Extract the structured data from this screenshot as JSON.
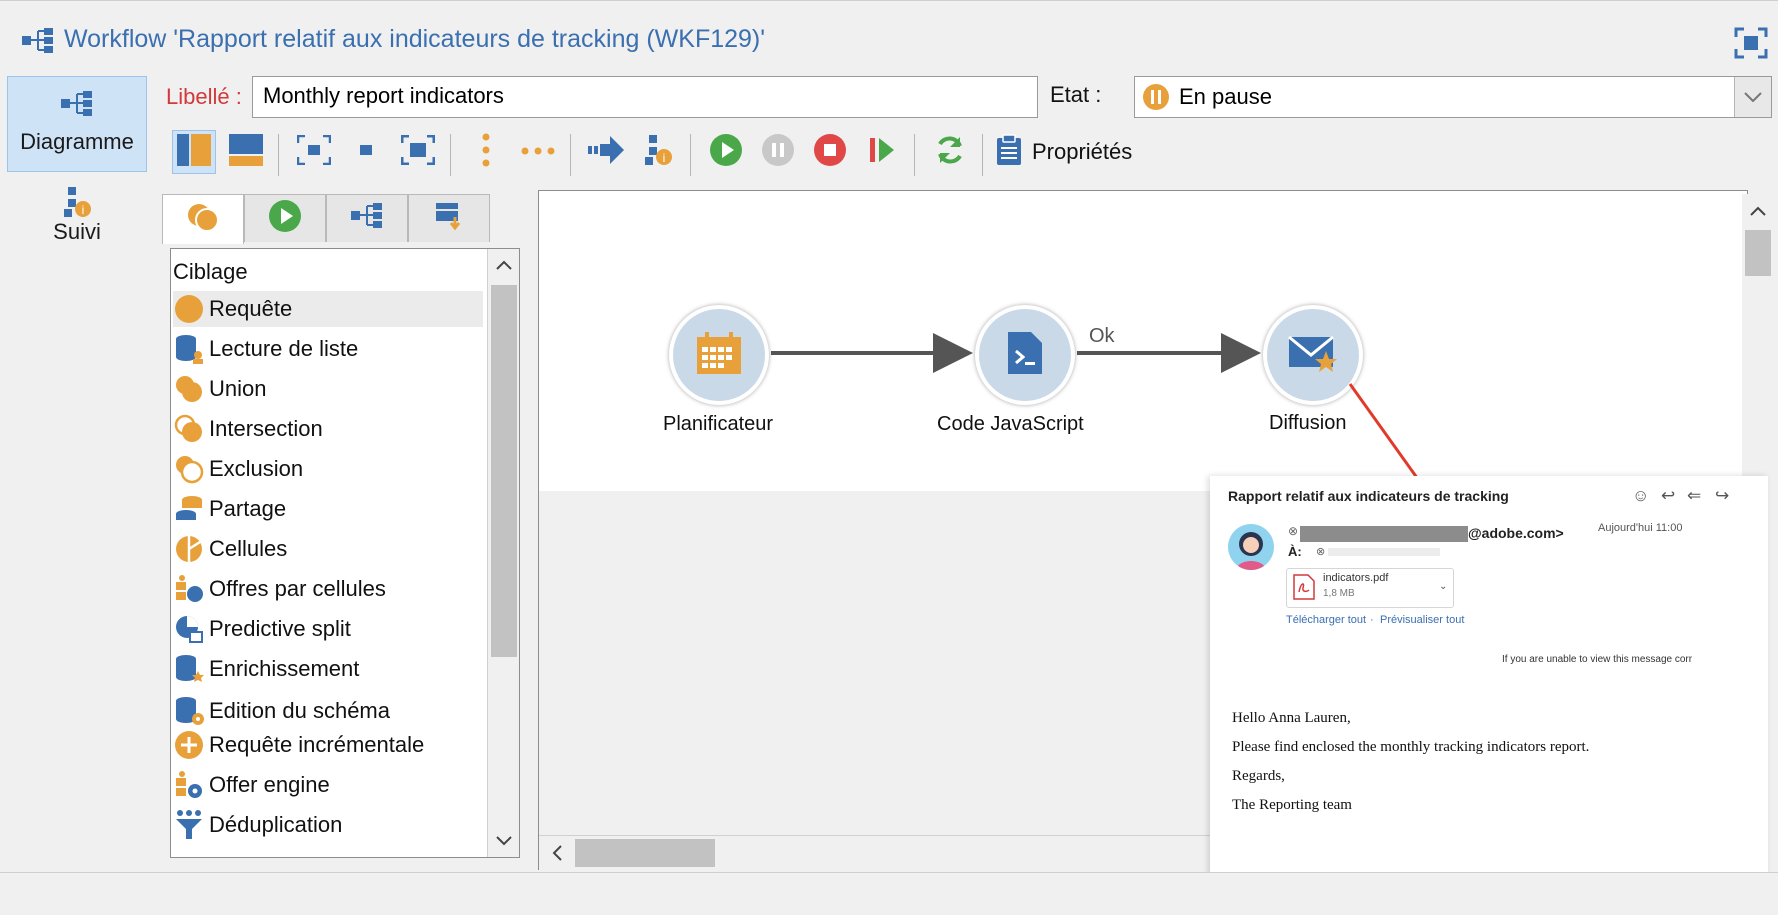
{
  "window": {
    "title": "Workflow 'Rapport relatif aux indicateurs de tracking  (WKF129)'",
    "accent_color": "#3a6fb0"
  },
  "sidebar": {
    "items": [
      {
        "label": "Diagramme",
        "icon": "diagram-icon",
        "active": true
      },
      {
        "label": "Suivi",
        "icon": "tracking-icon",
        "active": false
      }
    ]
  },
  "form": {
    "libelle_label": "Libellé :",
    "libelle_value": "Monthly report indicators",
    "etat_label": "Etat :",
    "etat_value": "En pause"
  },
  "toolbar": {
    "properties_label": "Propriétés",
    "buttons": [
      "layout-vertical-icon",
      "layout-horizontal-icon",
      "zoom-fit-icon",
      "zoom-normal-icon",
      "zoom-select-icon",
      "align-vertical-icon",
      "align-horizontal-icon",
      "arrow-right-icon",
      "workflow-properties-icon",
      "start-icon",
      "pause-icon",
      "stop-icon",
      "step-icon",
      "refresh-icon",
      "clipboard-icon"
    ]
  },
  "palette": {
    "tabs": [
      "targeting-tab-icon",
      "flow-control-tab-icon",
      "actions-tab-icon",
      "events-tab-icon"
    ],
    "category": "Ciblage",
    "items": [
      {
        "label": "Requête",
        "icon": "query-icon"
      },
      {
        "label": "Lecture de liste",
        "icon": "list-read-icon"
      },
      {
        "label": "Union",
        "icon": "union-icon"
      },
      {
        "label": "Intersection",
        "icon": "intersection-icon"
      },
      {
        "label": "Exclusion",
        "icon": "exclusion-icon"
      },
      {
        "label": "Partage",
        "icon": "split-icon"
      },
      {
        "label": "Cellules",
        "icon": "cells-icon"
      },
      {
        "label": "Offres par cellules",
        "icon": "offers-cells-icon"
      },
      {
        "label": "Predictive split",
        "icon": "predictive-split-icon"
      },
      {
        "label": "Enrichissement",
        "icon": "enrichment-icon"
      },
      {
        "label": "Edition du schéma",
        "icon": "schema-edit-icon"
      },
      {
        "label": "Requête incrémentale",
        "icon": "incremental-query-icon"
      },
      {
        "label": "Offer engine",
        "icon": "offer-engine-icon"
      },
      {
        "label": "Déduplication",
        "icon": "deduplication-icon"
      }
    ]
  },
  "canvas": {
    "nodes": [
      {
        "label": "Planificateur",
        "icon": "calendar-icon"
      },
      {
        "label": "Code JavaScript",
        "icon": "script-icon"
      },
      {
        "label": "Diffusion",
        "icon": "delivery-icon"
      }
    ],
    "transition_label": "Ok"
  },
  "email": {
    "subject": "Rapport relatif aux indicateurs de tracking",
    "from_suffix": "@adobe.com>",
    "to_label": "À:",
    "time": "Aujourd'hui 11:00",
    "attachment_name": "indicators.pdf",
    "attachment_size": "1,8 MB",
    "download_all": "Télécharger tout",
    "separator": "·",
    "preview_all": "Prévisualiser tout",
    "view_notice": "If you are unable to view this message corr",
    "body": [
      "Hello Anna Lauren,",
      "Please find enclosed the monthly tracking indicators report.",
      "Regards,",
      "The Reporting team"
    ]
  }
}
